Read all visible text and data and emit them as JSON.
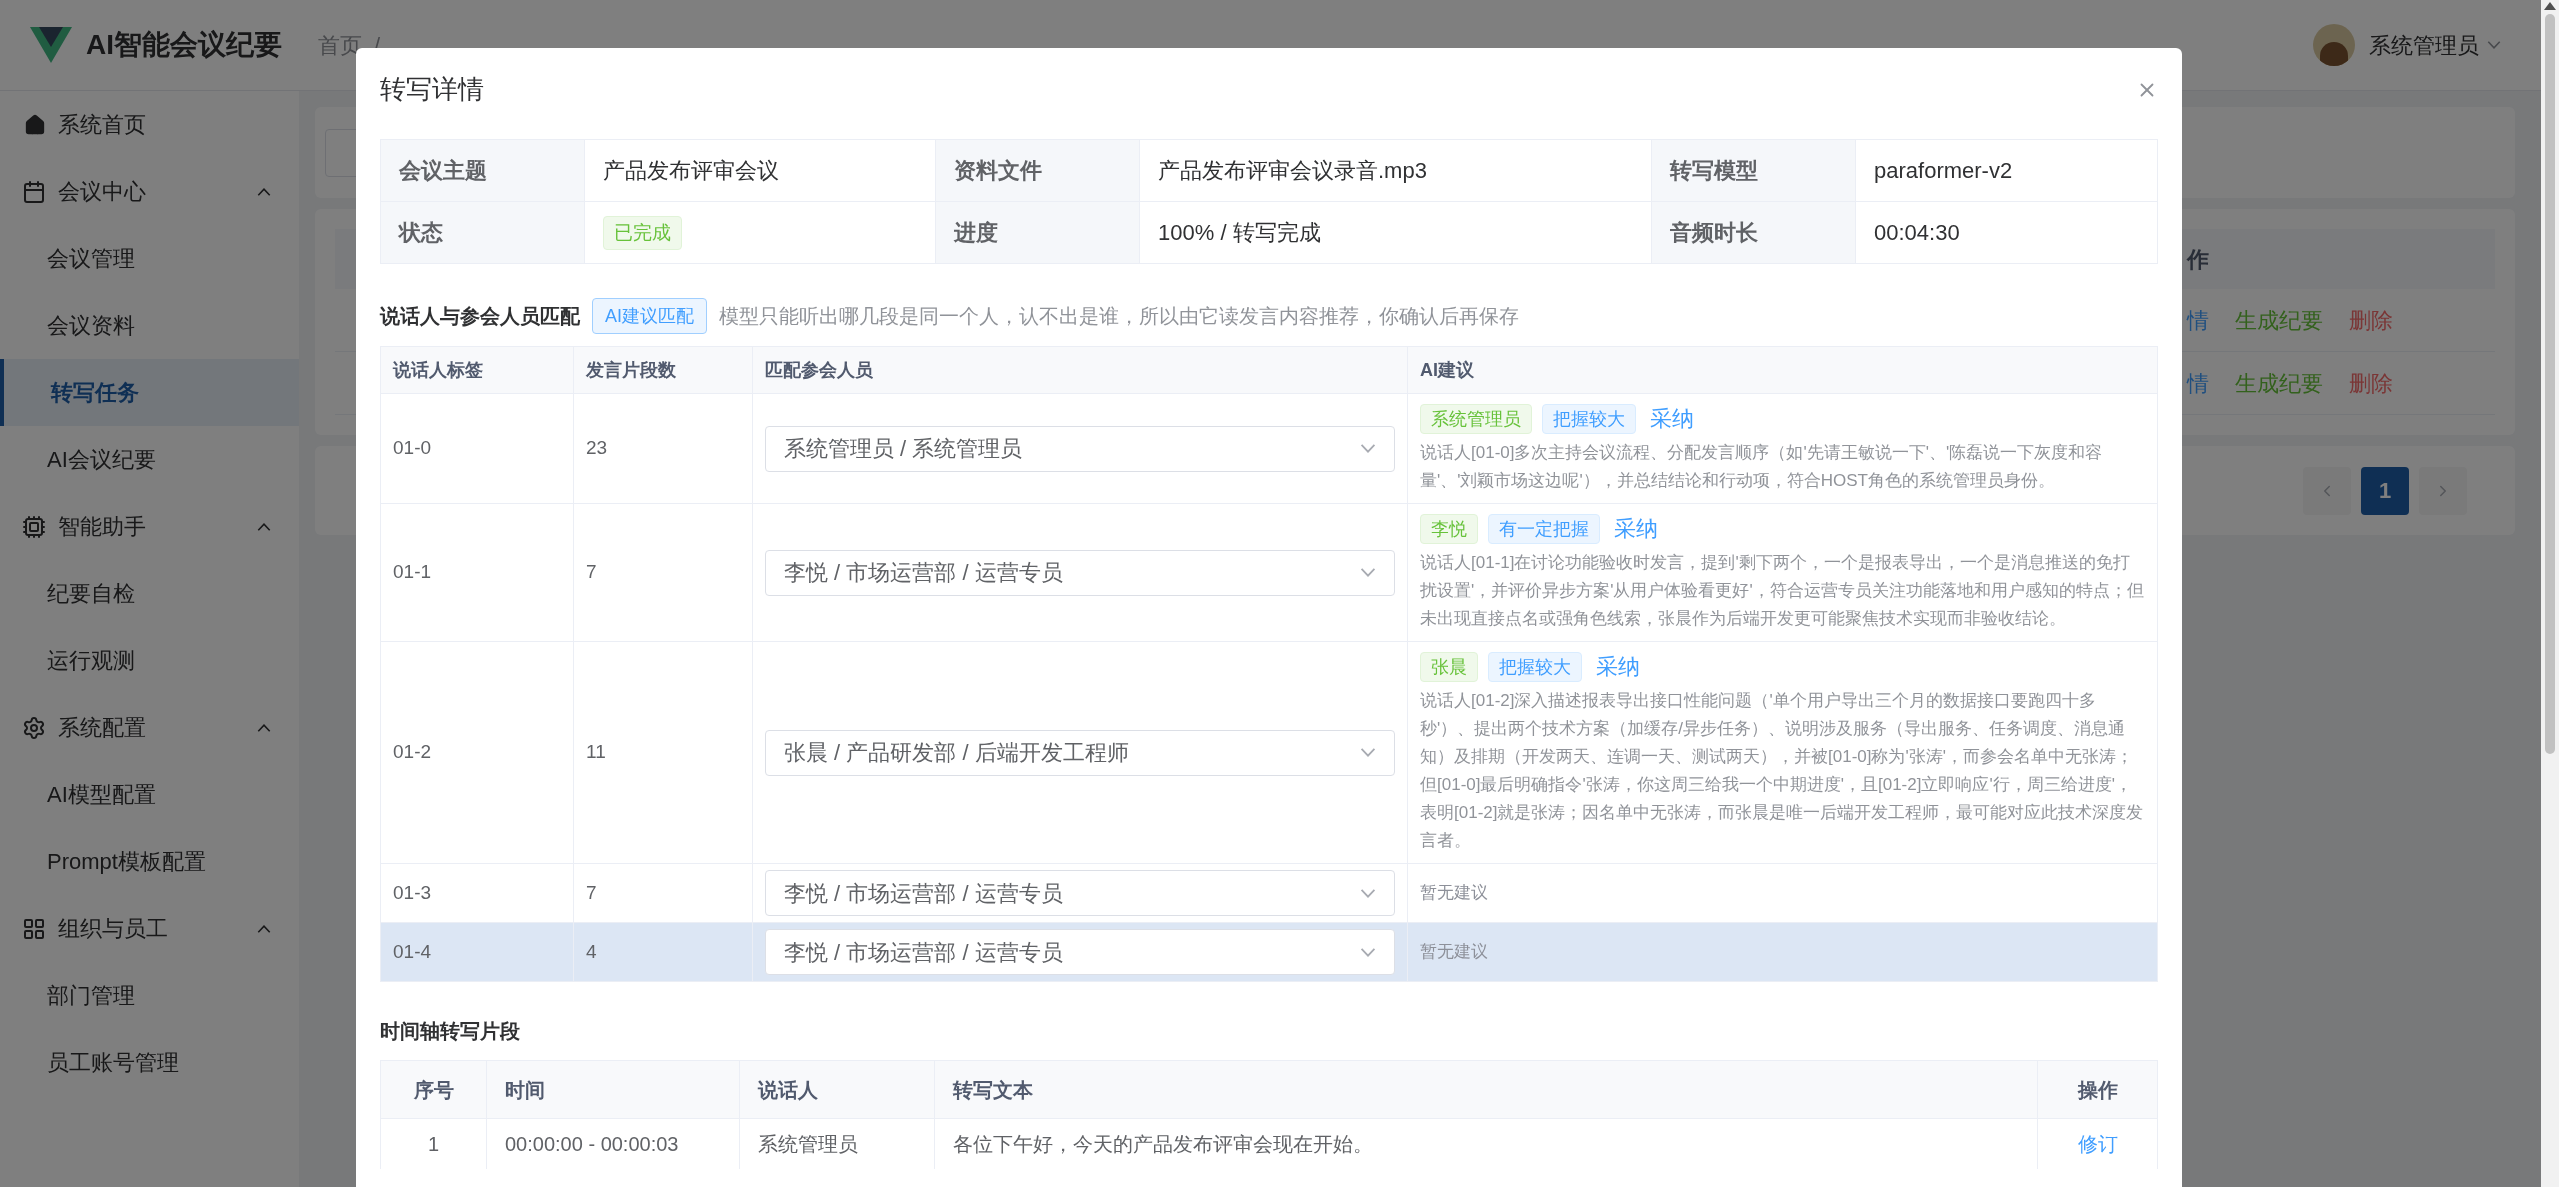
{
  "header": {
    "title": "AI智能会议纪要",
    "breadcrumb": [
      "首页"
    ],
    "breadcrumb_separator": "/",
    "user": "系统管理员"
  },
  "sidebar": {
    "items": [
      {
        "label": "系统首页",
        "selected": false
      },
      {
        "label": "会议中心",
        "selected": false,
        "expanded": true,
        "children": [
          {
            "label": "会议管理",
            "selected": false
          },
          {
            "label": "会议资料",
            "selected": false
          },
          {
            "label": "转写任务",
            "selected": true
          },
          {
            "label": "AI会议纪要",
            "selected": false
          }
        ]
      },
      {
        "label": "智能助手",
        "selected": false,
        "expanded": true,
        "children": [
          {
            "label": "纪要自检",
            "selected": false
          },
          {
            "label": "运行观测",
            "selected": false
          }
        ]
      },
      {
        "label": "系统配置",
        "selected": false,
        "expanded": true,
        "children": [
          {
            "label": "AI模型配置",
            "selected": false
          },
          {
            "label": "Prompt模板配置",
            "selected": false
          }
        ]
      },
      {
        "label": "组织与员工",
        "selected": false,
        "expanded": true,
        "children": [
          {
            "label": "部门管理",
            "selected": false
          },
          {
            "label": "员工账号管理",
            "selected": false
          }
        ]
      }
    ]
  },
  "background": {
    "table": {
      "column": "作",
      "rows": [
        {
          "actions": [
            {
              "label": "情",
              "kind": "view"
            },
            {
              "label": "生成纪要",
              "kind": "generate"
            },
            {
              "label": "删除",
              "kind": "delete"
            }
          ]
        },
        {
          "actions": [
            {
              "label": "情",
              "kind": "view"
            },
            {
              "label": "生成纪要",
              "kind": "generate"
            },
            {
              "label": "删除",
              "kind": "delete"
            }
          ]
        }
      ]
    },
    "pagination": {
      "pages": [
        {
          "label": "1",
          "selected": true
        }
      ]
    }
  },
  "dialog": {
    "title": "转写详情",
    "info": [
      [
        {
          "label": "会议主题",
          "value": "产品发布评审会议",
          "kind": "text"
        },
        {
          "label": "资料文件",
          "value": "产品发布评审会议录音.mp3",
          "kind": "text"
        },
        {
          "label": "转写模型",
          "value": "paraformer-v2",
          "kind": "text"
        }
      ],
      [
        {
          "label": "状态",
          "value": "已完成",
          "kind": "tag"
        },
        {
          "label": "进度",
          "value": "100% / 转写完成",
          "kind": "text"
        },
        {
          "label": "音频时长",
          "value": "00:04:30",
          "kind": "text"
        }
      ]
    ],
    "matching": {
      "title": "说话人与参会人员匹配",
      "button": "AI建议匹配",
      "hint": "模型只能听出哪几段是同一个人，认不出是谁，所以由它读发言内容推荐，你确认后再保存",
      "columns": [
        "说话人标签",
        "发言片段数",
        "匹配参会人员",
        "AI建议"
      ],
      "rows": [
        {
          "speaker": "01-0",
          "count": "23",
          "attendee": "系统管理员 / 系统管理员",
          "selected": false,
          "suggestion": {
            "name": "系统管理员",
            "confidence": "把握较大",
            "action": "采纳",
            "reason": "说话人[01-0]多次主持会议流程、分配发言顺序（如'先请王敏说一下'、'陈磊说一下灰度和容量'、'刘颖市场这边呢'），并总结结论和行动项，符合HOST角色的系统管理员身份。"
          }
        },
        {
          "speaker": "01-1",
          "count": "7",
          "attendee": "李悦 / 市场运营部 / 运营专员",
          "selected": false,
          "suggestion": {
            "name": "李悦",
            "confidence": "有一定把握",
            "action": "采纳",
            "reason": "说话人[01-1]在讨论功能验收时发言，提到'剩下两个，一个是报表导出，一个是消息推送的免打扰设置'，并评价异步方案'从用户体验看更好'，符合运营专员关注功能落地和用户感知的特点；但未出现直接点名或强角色线索，张晨作为后端开发更可能聚焦技术实现而非验收结论。"
          }
        },
        {
          "speaker": "01-2",
          "count": "11",
          "attendee": "张晨 / 产品研发部 / 后端开发工程师",
          "selected": false,
          "suggestion": {
            "name": "张晨",
            "confidence": "把握较大",
            "action": "采纳",
            "reason": "说话人[01-2]深入描述报表导出接口性能问题（'单个用户导出三个月的数据接口要跑四十多秒'）、提出两个技术方案（加缓存/异步任务）、说明涉及服务（导出服务、任务调度、消息通知）及排期（开发两天、连调一天、测试两天），并被[01-0]称为'张涛'，而参会名单中无张涛；但[01-0]最后明确指令'张涛，你这周三给我一个中期进度'，且[01-2]立即响应'行，周三给进度'，表明[01-2]就是张涛；因名单中无张涛，而张晨是唯一后端开发工程师，最可能对应此技术深度发言者。"
          }
        },
        {
          "speaker": "01-3",
          "count": "7",
          "attendee": "李悦 / 市场运营部 / 运营专员",
          "selected": false,
          "empty": "暂无建议"
        },
        {
          "speaker": "01-4",
          "count": "4",
          "attendee": "李悦 / 市场运营部 / 运营专员",
          "selected": true,
          "empty": "暂无建议"
        }
      ]
    },
    "timeline": {
      "title": "时间轴转写片段",
      "columns": [
        "序号",
        "时间",
        "说话人",
        "转写文本",
        "操作"
      ],
      "rows": [
        {
          "index": "1",
          "time": "00:00:00 - 00:00:03",
          "speaker": "系统管理员",
          "text": "各位下午好，今天的产品发布评审会现在开始。",
          "action": "修订"
        }
      ]
    }
  }
}
